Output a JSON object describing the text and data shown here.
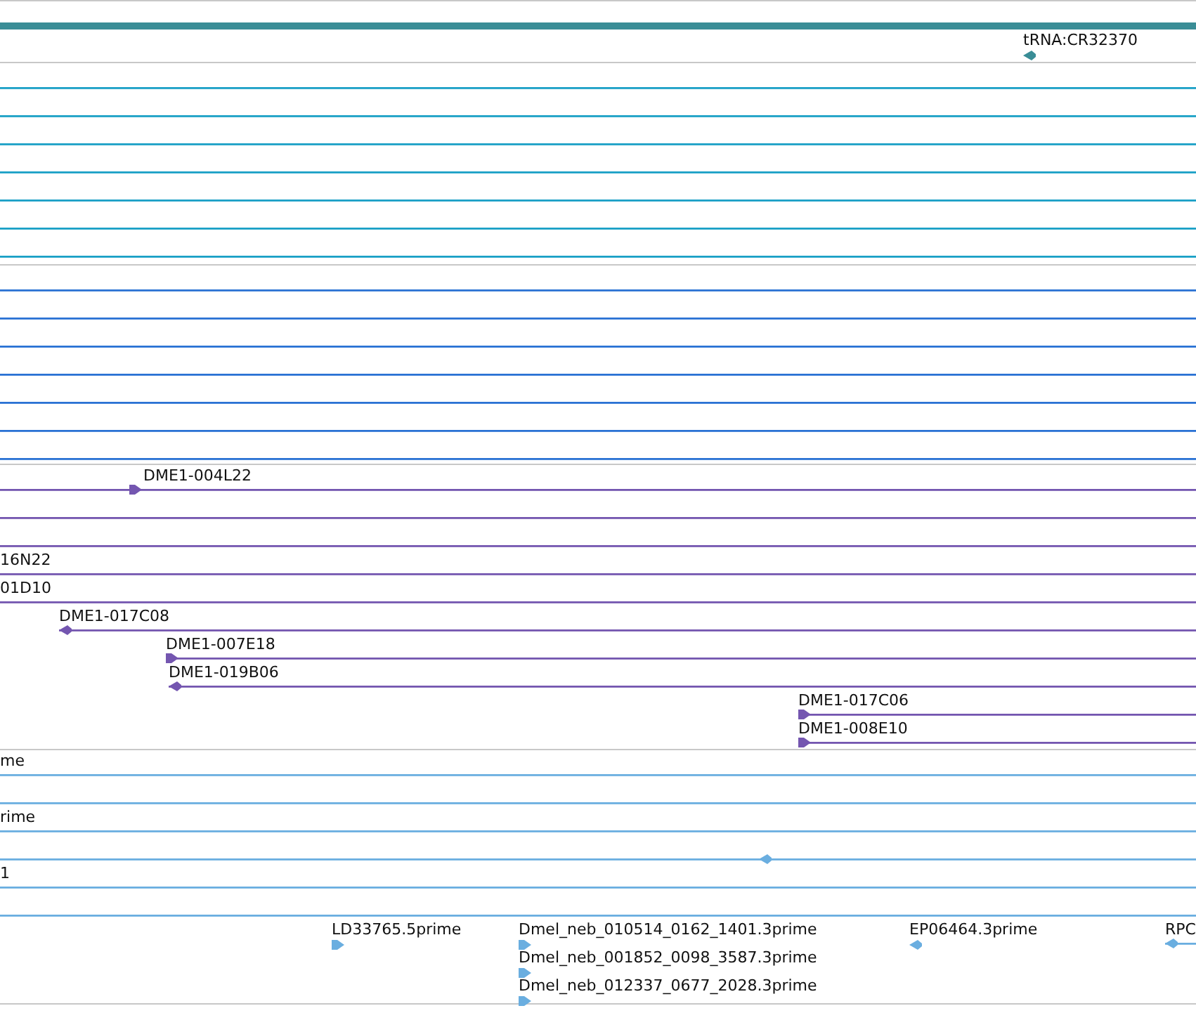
{
  "tracks": [
    {
      "color": "#3a8d96",
      "rows": [
        {
          "features": [
            {
              "kind": "bar",
              "arrow": false
            }
          ]
        },
        {
          "features": [
            {
              "kind": "point",
              "label": "tRNA:CR32370",
              "arrow": true,
              "reverse": true
            }
          ]
        }
      ]
    },
    {
      "color": "#1aa0c6",
      "rows": [
        {
          "features": [
            {
              "kind": "span",
              "arrow": false
            }
          ]
        },
        {
          "features": [
            {
              "kind": "span",
              "arrow": false
            }
          ]
        },
        {
          "features": [
            {
              "kind": "span",
              "arrow": false
            }
          ]
        },
        {
          "features": [
            {
              "kind": "span",
              "arrow": false
            }
          ]
        },
        {
          "features": [
            {
              "kind": "span",
              "arrow": false
            }
          ]
        },
        {
          "features": [
            {
              "kind": "span",
              "arrow": false
            }
          ]
        },
        {
          "features": [
            {
              "kind": "span",
              "arrow": false
            }
          ]
        }
      ]
    },
    {
      "color": "#2a72d4",
      "rows": [
        {
          "features": [
            {
              "kind": "span",
              "arrow": false
            }
          ]
        },
        {
          "features": [
            {
              "kind": "span",
              "arrow": false
            }
          ]
        },
        {
          "features": [
            {
              "kind": "span",
              "arrow": false
            }
          ]
        },
        {
          "features": [
            {
              "kind": "span",
              "arrow": false
            }
          ]
        },
        {
          "features": [
            {
              "kind": "span",
              "arrow": false
            }
          ]
        },
        {
          "features": [
            {
              "kind": "span",
              "arrow": false
            }
          ]
        },
        {
          "features": [
            {
              "kind": "span",
              "arrow": false
            }
          ]
        }
      ]
    },
    {
      "color": "#7456b0",
      "rows": [
        {
          "features": [
            {
              "kind": "span",
              "label": "DME1-004L22",
              "arrow": true,
              "reverse": false
            }
          ]
        },
        {
          "features": [
            {
              "kind": "span",
              "arrow": false
            }
          ]
        },
        {
          "features": [
            {
              "kind": "span",
              "arrow": false
            }
          ]
        },
        {
          "features": [
            {
              "kind": "span",
              "label": "16N22",
              "arrow": false
            }
          ]
        },
        {
          "features": [
            {
              "kind": "span",
              "label": "01D10",
              "arrow": false
            }
          ]
        },
        {
          "features": [
            {
              "kind": "span",
              "label": "DME1-017C08",
              "arrow": true,
              "reverse": true
            }
          ]
        },
        {
          "features": [
            {
              "kind": "span",
              "label": "DME1-007E18",
              "arrow": true,
              "reverse": false
            }
          ]
        },
        {
          "features": [
            {
              "kind": "span",
              "label": "DME1-019B06",
              "arrow": true,
              "reverse": true
            }
          ]
        },
        {
          "features": [
            {
              "kind": "span",
              "label": "DME1-017C06",
              "arrow": true,
              "reverse": false
            }
          ]
        },
        {
          "features": [
            {
              "kind": "span",
              "label": "DME1-008E10",
              "arrow": true,
              "reverse": false
            }
          ]
        }
      ]
    },
    {
      "color": "#6aaee0",
      "rows": [
        {
          "features": [
            {
              "kind": "span",
              "label": "me",
              "arrow": false
            }
          ]
        },
        {
          "features": [
            {
              "kind": "span",
              "arrow": false
            }
          ]
        },
        {
          "features": [
            {
              "kind": "span",
              "label": "rime",
              "arrow": false
            }
          ]
        },
        {
          "features": [
            {
              "kind": "span",
              "arrow": true,
              "reverse": true
            }
          ]
        },
        {
          "features": [
            {
              "kind": "span",
              "label": "1",
              "arrow": false
            }
          ]
        },
        {
          "features": [
            {
              "kind": "span",
              "arrow": false
            }
          ]
        },
        {
          "features": [
            {
              "kind": "point",
              "label": "LD33765.5prime",
              "arrow": true,
              "reverse": false
            },
            {
              "kind": "point",
              "label": "Dmel_neb_010514_0162_1401.3prime",
              "arrow": true,
              "reverse": false
            },
            {
              "kind": "point",
              "label": "EP06464.3prime",
              "arrow": true,
              "reverse": true
            },
            {
              "kind": "span",
              "label": "RPC",
              "arrow": true,
              "reverse": true
            }
          ]
        },
        {
          "features": [
            {
              "kind": "point",
              "label": "Dmel_neb_001852_0098_3587.3prime",
              "arrow": true,
              "reverse": false
            }
          ]
        },
        {
          "features": [
            {
              "kind": "point",
              "label": "Dmel_neb_012337_0677_2028.3prime",
              "arrow": true,
              "reverse": false
            }
          ]
        }
      ]
    }
  ]
}
